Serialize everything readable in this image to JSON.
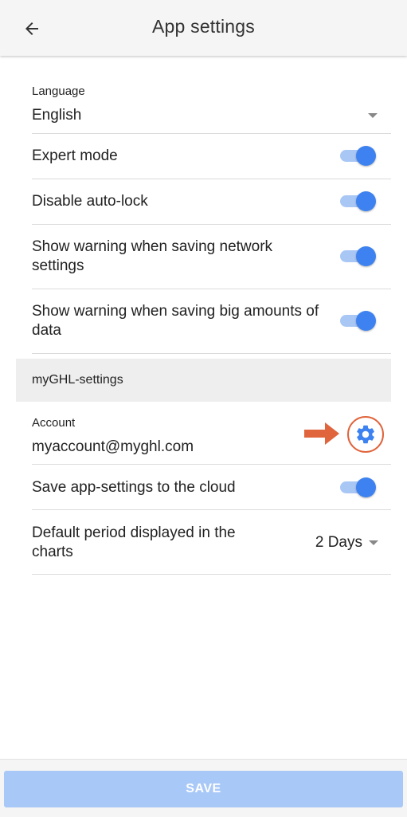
{
  "appbar": {
    "title": "App settings",
    "back_icon": "arrow-left-icon"
  },
  "language": {
    "label": "Language",
    "value": "English"
  },
  "toggles": [
    {
      "label": "Expert mode",
      "on": true
    },
    {
      "label": "Disable auto-lock",
      "on": true
    },
    {
      "label": "Show warning when saving network settings",
      "on": true
    },
    {
      "label": "Show warning when saving big amounts of data",
      "on": true
    }
  ],
  "section": {
    "title": "myGHL-settings"
  },
  "account": {
    "label": "Account",
    "value": "myaccount@myghl.com",
    "settings_icon": "gear-icon"
  },
  "cloud": {
    "label": "Save app-settings to the cloud",
    "on": true
  },
  "period": {
    "label": "Default period displayed in the charts",
    "value": "2 Days"
  },
  "footer": {
    "save_label": "SAVE"
  },
  "colors": {
    "accent": "#3d82f0",
    "annotation": "#e0643c",
    "save_disabled": "#a8c8f8"
  }
}
